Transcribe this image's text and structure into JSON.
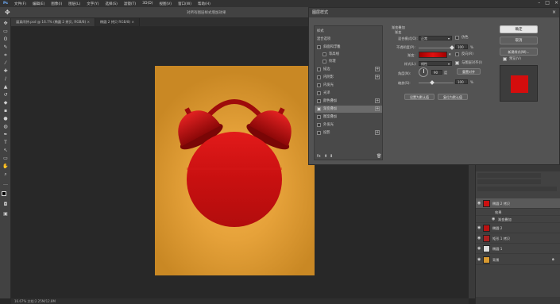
{
  "menu": [
    "文件(F)",
    "编辑(E)",
    "图像(I)",
    "图层(L)",
    "文字(Y)",
    "选择(S)",
    "滤镜(T)",
    "3D(D)",
    "视图(V)",
    "窗口(W)",
    "帮助(H)"
  ],
  "options_bar": {
    "center_text": "对所有图层样式增加效果"
  },
  "tabs": [
    {
      "label": "逼真闹钟.psd @ 16.7% (椭圆 2 拷贝, RGB/8) ×"
    },
    {
      "label": "椭圆 2 拷贝 RGB/8) ×"
    }
  ],
  "status": "16.67%   文档:2.25M/12.8M",
  "dialog": {
    "title": "图层样式",
    "list": [
      {
        "label": "样式",
        "checked": false
      },
      {
        "label": "混合选项",
        "checked": false
      },
      {
        "label": "斜面和浮雕",
        "checked": false
      },
      {
        "label": "等高线",
        "checked": false
      },
      {
        "label": "纹理",
        "checked": false
      },
      {
        "label": "描边",
        "checked": false
      },
      {
        "label": "内阴影",
        "checked": false
      },
      {
        "label": "内发光",
        "checked": false
      },
      {
        "label": "光泽",
        "checked": false
      },
      {
        "label": "颜色叠加",
        "checked": false
      },
      {
        "label": "渐变叠加",
        "checked": true
      },
      {
        "label": "图案叠加",
        "checked": false
      },
      {
        "label": "外发光",
        "checked": false
      },
      {
        "label": "投影",
        "checked": false
      }
    ],
    "section_title": "渐变叠加",
    "sub_title": "渐变",
    "blend_mode_label": "混合模式(O):",
    "blend_mode_value": "正常",
    "dither_label": "仿色",
    "opacity_label": "不透明度(P):",
    "opacity_value": "100",
    "percent": "%",
    "gradient_label": "渐变:",
    "gradient_colors": [
      "#a00000",
      "#e01010",
      "#a00000"
    ],
    "reverse_label": "反向(R)",
    "style_label": "样式(L):",
    "style_value": "线性",
    "align_label": "与图层对齐(I)",
    "angle_label": "角度(N):",
    "angle_value": "90",
    "angle_unit": "度",
    "reset_align_label": "重置对齐",
    "scale_label": "缩放(S):",
    "scale_value": "100",
    "set_default": "设置为默认值",
    "reset_default": "复位为默认值",
    "ok": "确定",
    "cancel": "取消",
    "new_style": "新建样式(W)...",
    "preview_label": "预览(V)",
    "preview_color": "#d40d0d"
  },
  "layers": {
    "rows": [
      {
        "name": "椭圆 2 拷贝",
        "thumb": "#cc1010",
        "selected": true
      },
      {
        "name": "效果",
        "thumb": "",
        "selected": false
      },
      {
        "name": "渐变叠加",
        "thumb": "",
        "selected": false
      },
      {
        "name": "椭圆 2",
        "thumb": "#bb1010",
        "selected": false
      },
      {
        "name": "矩形 1 拷贝",
        "thumb": "#aa2020",
        "selected": false
      },
      {
        "name": "椭圆 1",
        "thumb": "#dddddd",
        "selected": false
      },
      {
        "name": "背景",
        "thumb": "#d99a30",
        "selected": false
      }
    ]
  }
}
